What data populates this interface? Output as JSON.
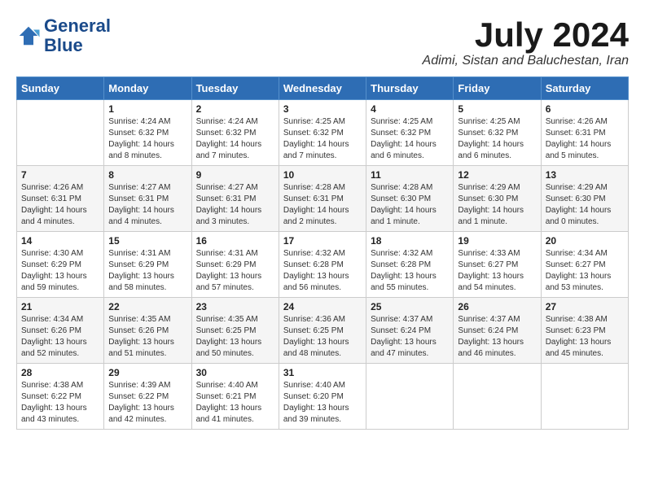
{
  "logo": {
    "line1": "General",
    "line2": "Blue"
  },
  "title": "July 2024",
  "location": "Adimi, Sistan and Baluchestan, Iran",
  "headers": [
    "Sunday",
    "Monday",
    "Tuesday",
    "Wednesday",
    "Thursday",
    "Friday",
    "Saturday"
  ],
  "weeks": [
    [
      {
        "day": "",
        "sunrise": "",
        "sunset": "",
        "daylight": ""
      },
      {
        "day": "1",
        "sunrise": "Sunrise: 4:24 AM",
        "sunset": "Sunset: 6:32 PM",
        "daylight": "Daylight: 14 hours and 8 minutes."
      },
      {
        "day": "2",
        "sunrise": "Sunrise: 4:24 AM",
        "sunset": "Sunset: 6:32 PM",
        "daylight": "Daylight: 14 hours and 7 minutes."
      },
      {
        "day": "3",
        "sunrise": "Sunrise: 4:25 AM",
        "sunset": "Sunset: 6:32 PM",
        "daylight": "Daylight: 14 hours and 7 minutes."
      },
      {
        "day": "4",
        "sunrise": "Sunrise: 4:25 AM",
        "sunset": "Sunset: 6:32 PM",
        "daylight": "Daylight: 14 hours and 6 minutes."
      },
      {
        "day": "5",
        "sunrise": "Sunrise: 4:25 AM",
        "sunset": "Sunset: 6:32 PM",
        "daylight": "Daylight: 14 hours and 6 minutes."
      },
      {
        "day": "6",
        "sunrise": "Sunrise: 4:26 AM",
        "sunset": "Sunset: 6:31 PM",
        "daylight": "Daylight: 14 hours and 5 minutes."
      }
    ],
    [
      {
        "day": "7",
        "sunrise": "Sunrise: 4:26 AM",
        "sunset": "Sunset: 6:31 PM",
        "daylight": "Daylight: 14 hours and 4 minutes."
      },
      {
        "day": "8",
        "sunrise": "Sunrise: 4:27 AM",
        "sunset": "Sunset: 6:31 PM",
        "daylight": "Daylight: 14 hours and 4 minutes."
      },
      {
        "day": "9",
        "sunrise": "Sunrise: 4:27 AM",
        "sunset": "Sunset: 6:31 PM",
        "daylight": "Daylight: 14 hours and 3 minutes."
      },
      {
        "day": "10",
        "sunrise": "Sunrise: 4:28 AM",
        "sunset": "Sunset: 6:31 PM",
        "daylight": "Daylight: 14 hours and 2 minutes."
      },
      {
        "day": "11",
        "sunrise": "Sunrise: 4:28 AM",
        "sunset": "Sunset: 6:30 PM",
        "daylight": "Daylight: 14 hours and 1 minute."
      },
      {
        "day": "12",
        "sunrise": "Sunrise: 4:29 AM",
        "sunset": "Sunset: 6:30 PM",
        "daylight": "Daylight: 14 hours and 1 minute."
      },
      {
        "day": "13",
        "sunrise": "Sunrise: 4:29 AM",
        "sunset": "Sunset: 6:30 PM",
        "daylight": "Daylight: 14 hours and 0 minutes."
      }
    ],
    [
      {
        "day": "14",
        "sunrise": "Sunrise: 4:30 AM",
        "sunset": "Sunset: 6:29 PM",
        "daylight": "Daylight: 13 hours and 59 minutes."
      },
      {
        "day": "15",
        "sunrise": "Sunrise: 4:31 AM",
        "sunset": "Sunset: 6:29 PM",
        "daylight": "Daylight: 13 hours and 58 minutes."
      },
      {
        "day": "16",
        "sunrise": "Sunrise: 4:31 AM",
        "sunset": "Sunset: 6:29 PM",
        "daylight": "Daylight: 13 hours and 57 minutes."
      },
      {
        "day": "17",
        "sunrise": "Sunrise: 4:32 AM",
        "sunset": "Sunset: 6:28 PM",
        "daylight": "Daylight: 13 hours and 56 minutes."
      },
      {
        "day": "18",
        "sunrise": "Sunrise: 4:32 AM",
        "sunset": "Sunset: 6:28 PM",
        "daylight": "Daylight: 13 hours and 55 minutes."
      },
      {
        "day": "19",
        "sunrise": "Sunrise: 4:33 AM",
        "sunset": "Sunset: 6:27 PM",
        "daylight": "Daylight: 13 hours and 54 minutes."
      },
      {
        "day": "20",
        "sunrise": "Sunrise: 4:34 AM",
        "sunset": "Sunset: 6:27 PM",
        "daylight": "Daylight: 13 hours and 53 minutes."
      }
    ],
    [
      {
        "day": "21",
        "sunrise": "Sunrise: 4:34 AM",
        "sunset": "Sunset: 6:26 PM",
        "daylight": "Daylight: 13 hours and 52 minutes."
      },
      {
        "day": "22",
        "sunrise": "Sunrise: 4:35 AM",
        "sunset": "Sunset: 6:26 PM",
        "daylight": "Daylight: 13 hours and 51 minutes."
      },
      {
        "day": "23",
        "sunrise": "Sunrise: 4:35 AM",
        "sunset": "Sunset: 6:25 PM",
        "daylight": "Daylight: 13 hours and 50 minutes."
      },
      {
        "day": "24",
        "sunrise": "Sunrise: 4:36 AM",
        "sunset": "Sunset: 6:25 PM",
        "daylight": "Daylight: 13 hours and 48 minutes."
      },
      {
        "day": "25",
        "sunrise": "Sunrise: 4:37 AM",
        "sunset": "Sunset: 6:24 PM",
        "daylight": "Daylight: 13 hours and 47 minutes."
      },
      {
        "day": "26",
        "sunrise": "Sunrise: 4:37 AM",
        "sunset": "Sunset: 6:24 PM",
        "daylight": "Daylight: 13 hours and 46 minutes."
      },
      {
        "day": "27",
        "sunrise": "Sunrise: 4:38 AM",
        "sunset": "Sunset: 6:23 PM",
        "daylight": "Daylight: 13 hours and 45 minutes."
      }
    ],
    [
      {
        "day": "28",
        "sunrise": "Sunrise: 4:38 AM",
        "sunset": "Sunset: 6:22 PM",
        "daylight": "Daylight: 13 hours and 43 minutes."
      },
      {
        "day": "29",
        "sunrise": "Sunrise: 4:39 AM",
        "sunset": "Sunset: 6:22 PM",
        "daylight": "Daylight: 13 hours and 42 minutes."
      },
      {
        "day": "30",
        "sunrise": "Sunrise: 4:40 AM",
        "sunset": "Sunset: 6:21 PM",
        "daylight": "Daylight: 13 hours and 41 minutes."
      },
      {
        "day": "31",
        "sunrise": "Sunrise: 4:40 AM",
        "sunset": "Sunset: 6:20 PM",
        "daylight": "Daylight: 13 hours and 39 minutes."
      },
      {
        "day": "",
        "sunrise": "",
        "sunset": "",
        "daylight": ""
      },
      {
        "day": "",
        "sunrise": "",
        "sunset": "",
        "daylight": ""
      },
      {
        "day": "",
        "sunrise": "",
        "sunset": "",
        "daylight": ""
      }
    ]
  ]
}
